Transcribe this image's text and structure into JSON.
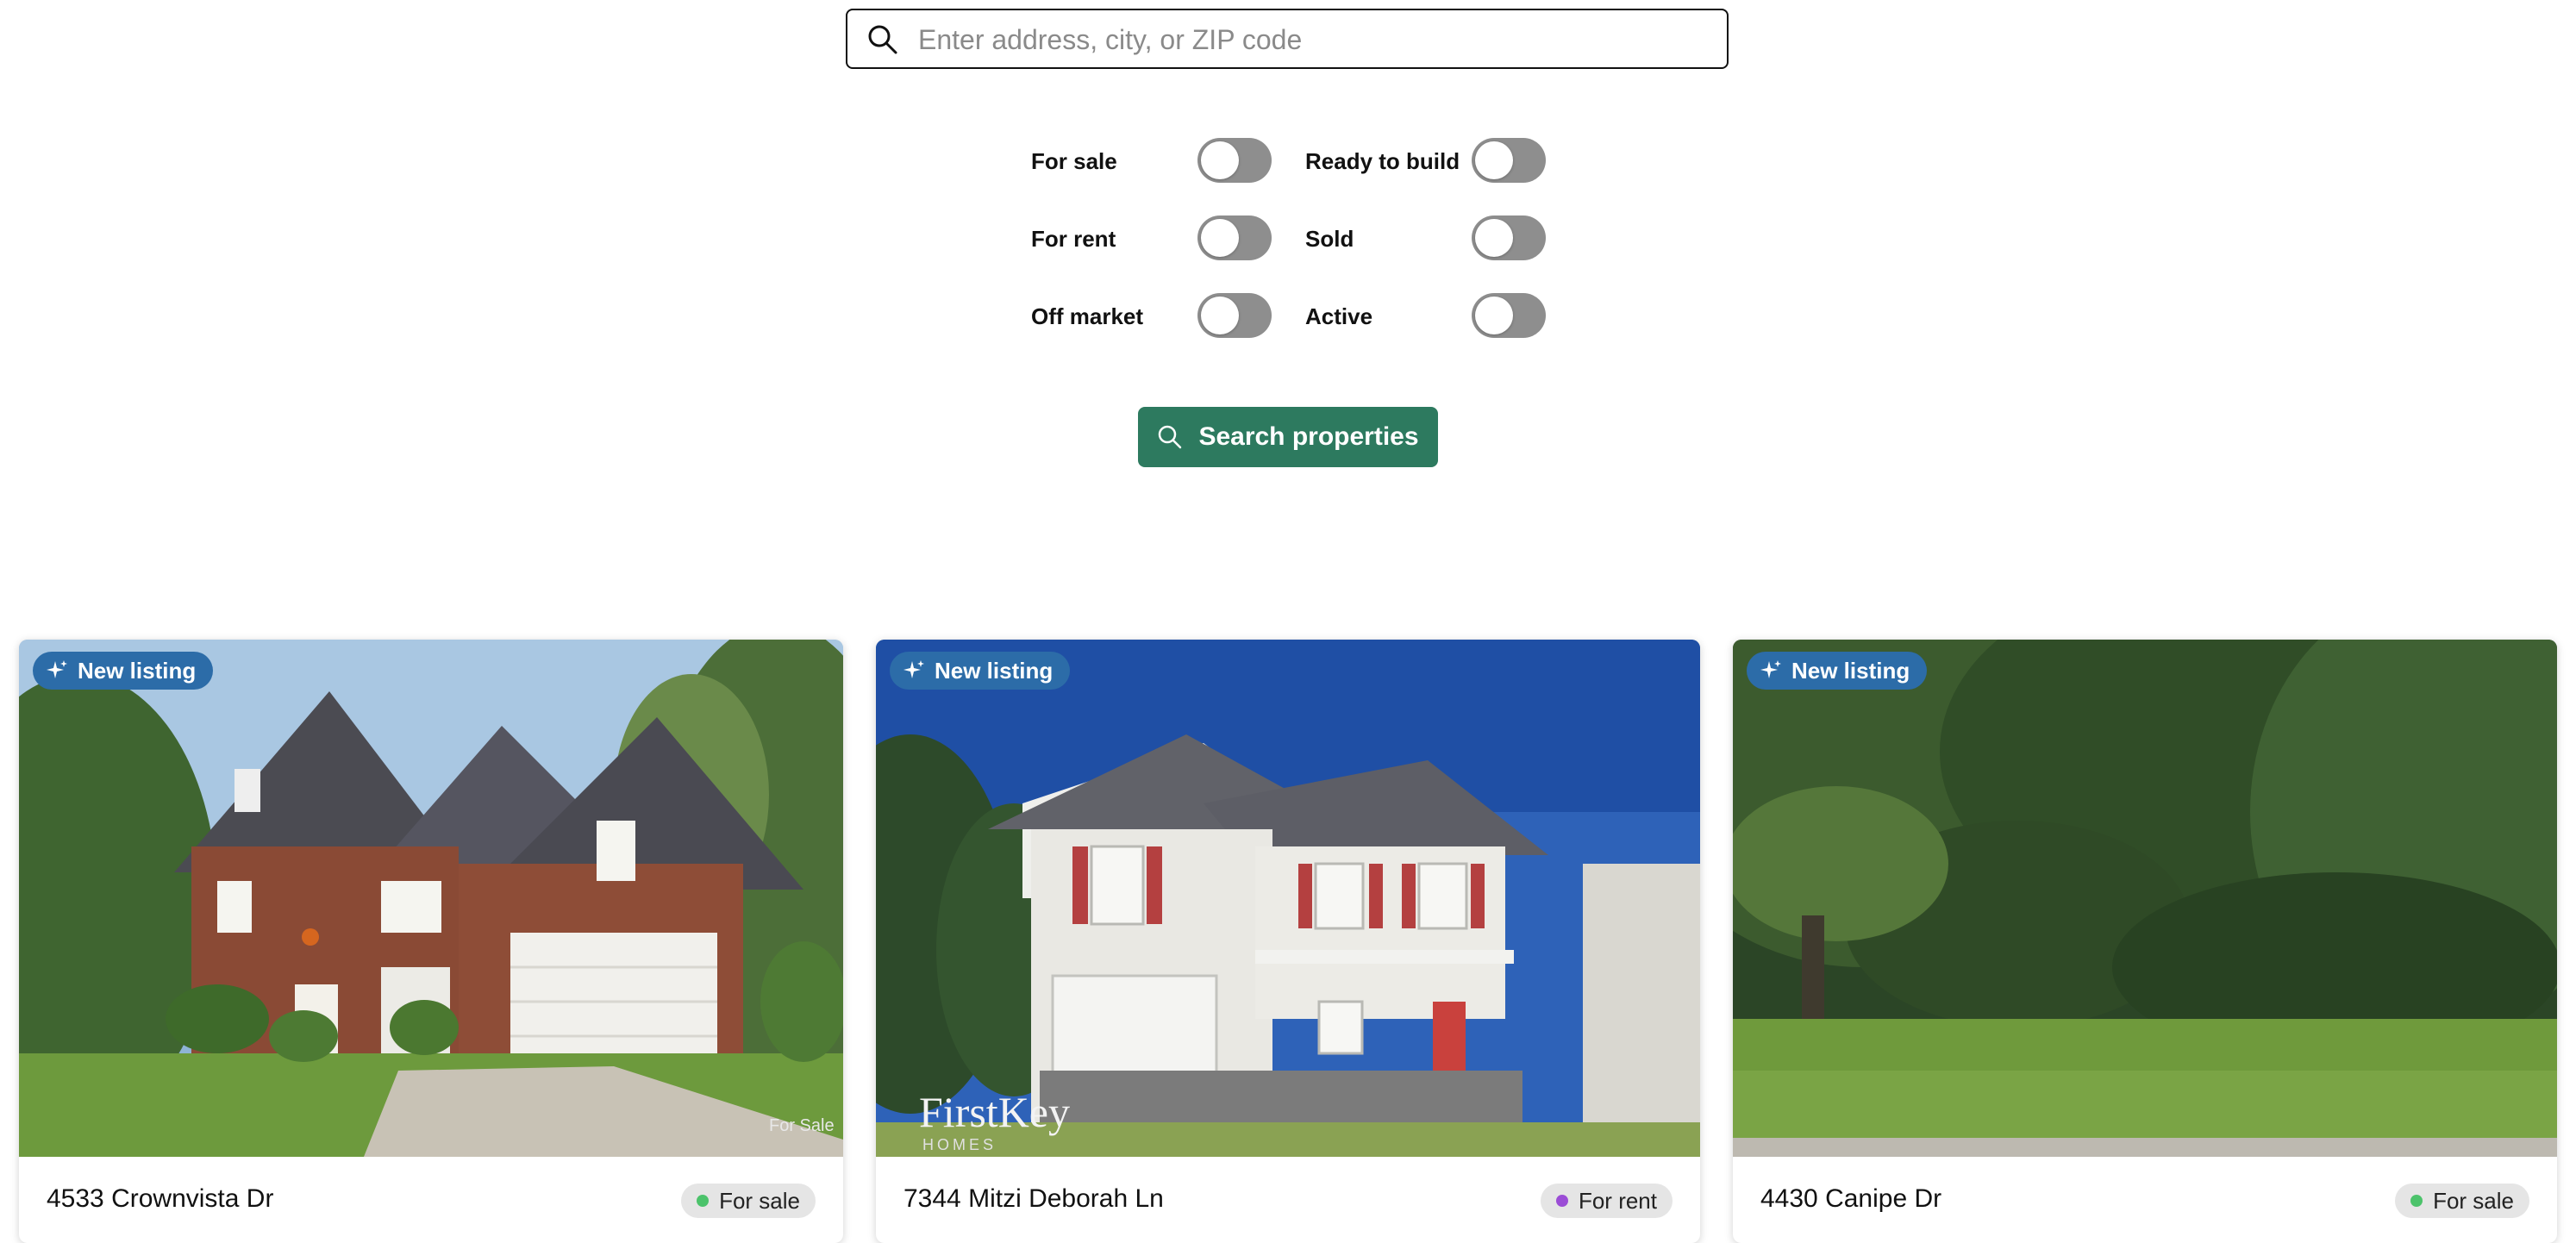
{
  "search": {
    "placeholder": "Enter address, city, or ZIP code",
    "value": ""
  },
  "filters": [
    {
      "label": "For sale",
      "on": false
    },
    {
      "label": "Ready to build",
      "on": false
    },
    {
      "label": "For rent",
      "on": false
    },
    {
      "label": "Sold",
      "on": false
    },
    {
      "label": "Off market",
      "on": false
    },
    {
      "label": "Active",
      "on": false
    }
  ],
  "search_button": {
    "label": "Search properties",
    "icon": "search-icon"
  },
  "colors": {
    "primary": "#2d7a5f",
    "new_badge": "#2c6ca8",
    "toggle_off": "#8e8e8e",
    "for_sale_dot": "#4cc36b",
    "for_rent_dot": "#9b4dd6"
  },
  "listings": [
    {
      "badge": "New listing",
      "badge_icon": "sparkle-icon",
      "address": "4533 Crownvista Dr",
      "status": "For sale",
      "status_color": "#4cc36b",
      "photo_watermark": "For Sale"
    },
    {
      "badge": "New listing",
      "badge_icon": "sparkle-icon",
      "address": "7344 Mitzi Deborah Ln",
      "status": "For rent",
      "status_color": "#9b4dd6",
      "photo_watermark": "FirstKey",
      "photo_watermark_sub": "HOMES"
    },
    {
      "badge": "New listing",
      "badge_icon": "sparkle-icon",
      "address": "4430 Canipe Dr",
      "status": "For sale",
      "status_color": "#4cc36b"
    }
  ]
}
